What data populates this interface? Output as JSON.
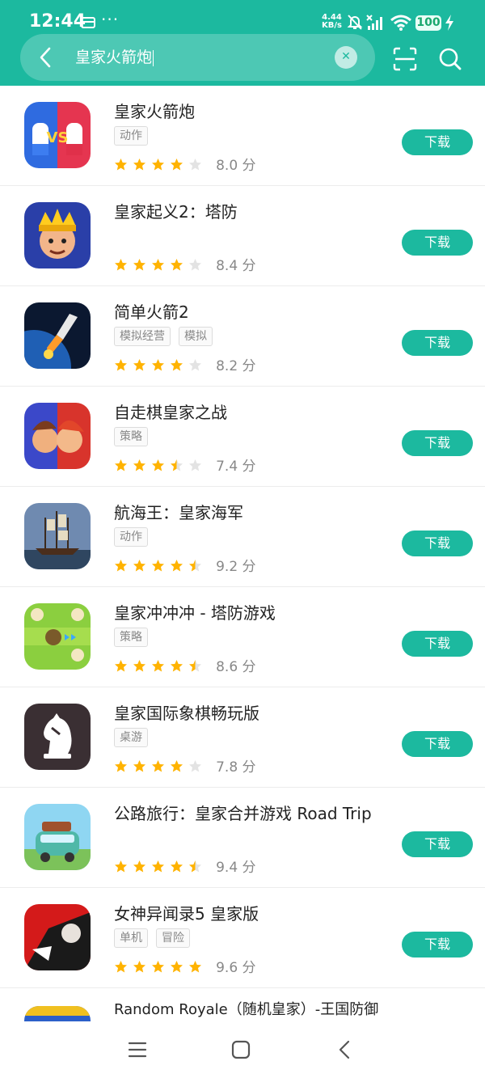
{
  "status_bar": {
    "time": "12:44",
    "more": "···",
    "net_speed_value": "4.44",
    "net_speed_unit": "KB/s",
    "battery": "100"
  },
  "search": {
    "query": "皇家火箭炮"
  },
  "download_label": "下载",
  "score_unit": "分",
  "apps": [
    {
      "name": "皇家火箭炮",
      "tags": [
        "动作"
      ],
      "rating": 4,
      "score": "8.0"
    },
    {
      "name": "皇家起义2：塔防",
      "tags": [],
      "rating": 4,
      "score": "8.4"
    },
    {
      "name": "简单火箭2",
      "tags": [
        "模拟经营",
        "模拟"
      ],
      "rating": 4,
      "score": "8.2"
    },
    {
      "name": "自走棋皇家之战",
      "tags": [
        "策略"
      ],
      "rating": 3.5,
      "score": "7.4"
    },
    {
      "name": "航海王：皇家海军",
      "tags": [
        "动作"
      ],
      "rating": 4.5,
      "score": "9.2"
    },
    {
      "name": "皇家冲冲冲 - 塔防游戏",
      "tags": [
        "策略"
      ],
      "rating": 4.5,
      "score": "8.6"
    },
    {
      "name": "皇家国际象棋畅玩版",
      "tags": [
        "桌游"
      ],
      "rating": 4,
      "score": "7.8"
    },
    {
      "name": "公路旅行：皇家合并游戏 Road Trip",
      "tags": [],
      "rating": 4.5,
      "score": "9.4"
    },
    {
      "name": "女神异闻录5 皇家版",
      "tags": [
        "单机",
        "冒险"
      ],
      "rating": 5,
      "score": "9.6"
    },
    {
      "name": "Random Royale（随机皇家）-王国防御策略游戏",
      "tags": [],
      "rating": 0,
      "score": ""
    }
  ],
  "colors": {
    "accent": "#1cb99f",
    "star_on": "#ffb300",
    "star_off": "#e3e3e3"
  }
}
